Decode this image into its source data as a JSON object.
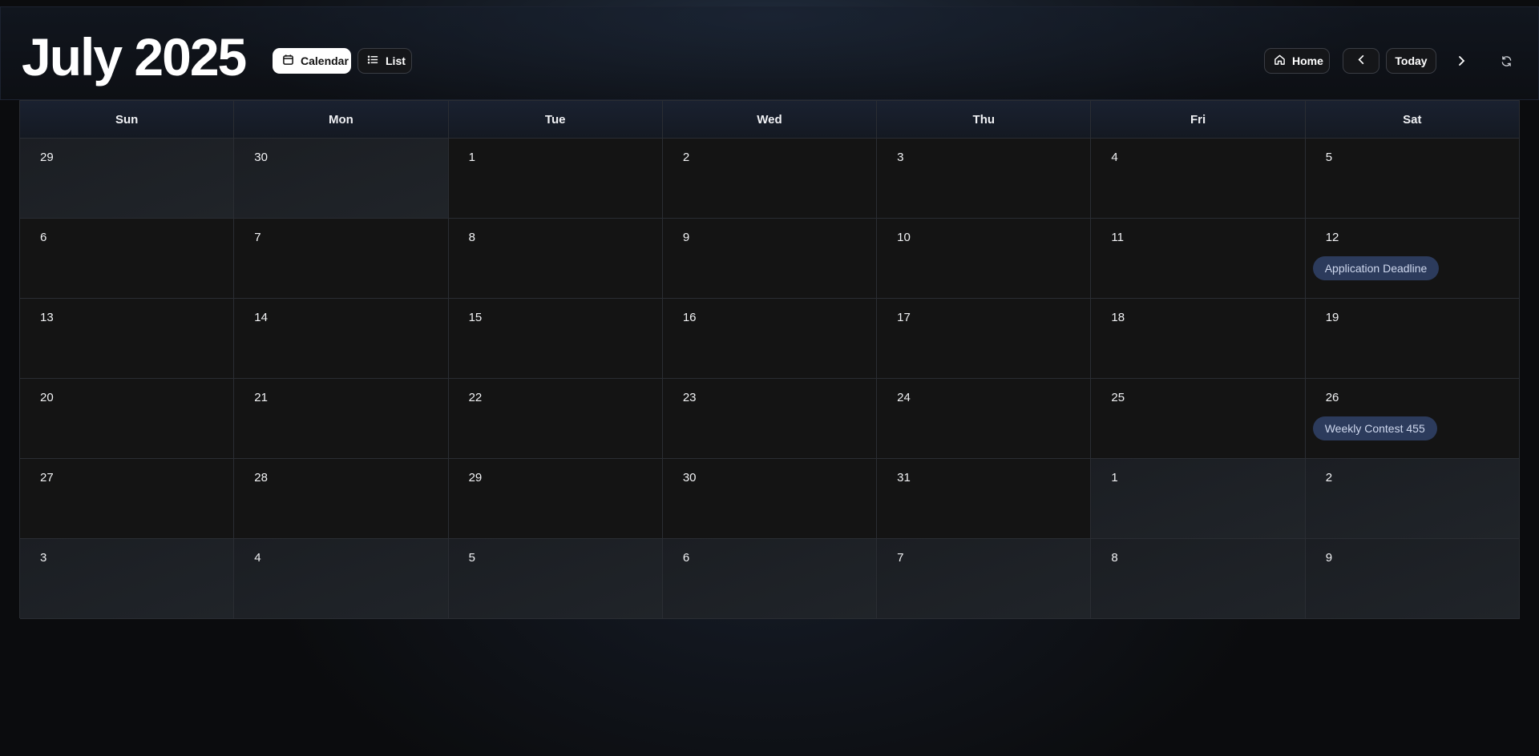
{
  "header": {
    "title": "July 2025",
    "view_calendar_label": "Calendar",
    "view_list_label": "List",
    "home_label": "Home",
    "today_label": "Today"
  },
  "calendar": {
    "weekdays": [
      "Sun",
      "Mon",
      "Tue",
      "Wed",
      "Thu",
      "Fri",
      "Sat"
    ],
    "weeks": [
      [
        {
          "day": "29",
          "other": true
        },
        {
          "day": "30",
          "other": true
        },
        {
          "day": "1"
        },
        {
          "day": "2"
        },
        {
          "day": "3"
        },
        {
          "day": "4"
        },
        {
          "day": "5"
        }
      ],
      [
        {
          "day": "6"
        },
        {
          "day": "7"
        },
        {
          "day": "8"
        },
        {
          "day": "9"
        },
        {
          "day": "10"
        },
        {
          "day": "11"
        },
        {
          "day": "12",
          "event": "Application Deadline"
        }
      ],
      [
        {
          "day": "13"
        },
        {
          "day": "14"
        },
        {
          "day": "15"
        },
        {
          "day": "16"
        },
        {
          "day": "17"
        },
        {
          "day": "18"
        },
        {
          "day": "19"
        }
      ],
      [
        {
          "day": "20"
        },
        {
          "day": "21"
        },
        {
          "day": "22"
        },
        {
          "day": "23"
        },
        {
          "day": "24"
        },
        {
          "day": "25"
        },
        {
          "day": "26",
          "event": "Weekly Contest 455"
        }
      ],
      [
        {
          "day": "27"
        },
        {
          "day": "28"
        },
        {
          "day": "29"
        },
        {
          "day": "30"
        },
        {
          "day": "31"
        },
        {
          "day": "1",
          "other": true
        },
        {
          "day": "2",
          "other": true
        }
      ],
      [
        {
          "day": "3",
          "other": true
        },
        {
          "day": "4",
          "other": true
        },
        {
          "day": "5",
          "other": true
        },
        {
          "day": "6",
          "other": true
        },
        {
          "day": "7",
          "other": true
        },
        {
          "day": "8",
          "other": true
        },
        {
          "day": "9",
          "other": true
        }
      ]
    ]
  },
  "colors": {
    "event_bg": "#2c3b5c",
    "event_text": "#cfd8ee",
    "active_view_bg": "#ffffff"
  }
}
